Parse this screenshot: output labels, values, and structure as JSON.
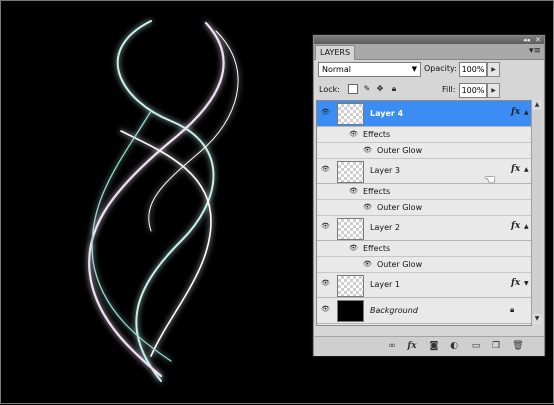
{
  "panel": {
    "tab_label": "LAYERS",
    "menu_icon": "panel-menu-icon",
    "collapse_icon": "double-chevron-icon",
    "close_icon": "close-icon"
  },
  "blend": {
    "mode": "Normal"
  },
  "opacity": {
    "label": "Opacity:",
    "value": "100%"
  },
  "lock": {
    "label": "Lock:",
    "icons": [
      "lock-transparent-icon",
      "lock-paint-icon",
      "lock-move-icon",
      "lock-all-icon"
    ]
  },
  "fill": {
    "label": "Fill:",
    "value": "100%"
  },
  "layers": [
    {
      "name": "Layer 4",
      "selected": true,
      "has_fx": true,
      "effects_label": "Effects",
      "effect": "Outer Glow"
    },
    {
      "name": "Layer 3",
      "selected": false,
      "has_fx": true,
      "effects_label": "Effects",
      "effect": "Outer Glow"
    },
    {
      "name": "Layer 2",
      "selected": false,
      "has_fx": true,
      "effects_label": "Effects",
      "effect": "Outer Glow"
    },
    {
      "name": "Layer 1",
      "selected": false,
      "has_fx": true
    },
    {
      "name": "Background",
      "selected": false,
      "has_fx": false,
      "locked": true
    }
  ],
  "fx_label": "fx",
  "bottom_icons": [
    "link-icon",
    "fx-icon",
    "mask-icon",
    "adjustment-icon",
    "folder-icon",
    "new-layer-icon",
    "trash-icon"
  ],
  "colors": {
    "selection": "#3b8df3",
    "panel_bg": "#d6d6d6",
    "canvas_bg": "#000000"
  }
}
